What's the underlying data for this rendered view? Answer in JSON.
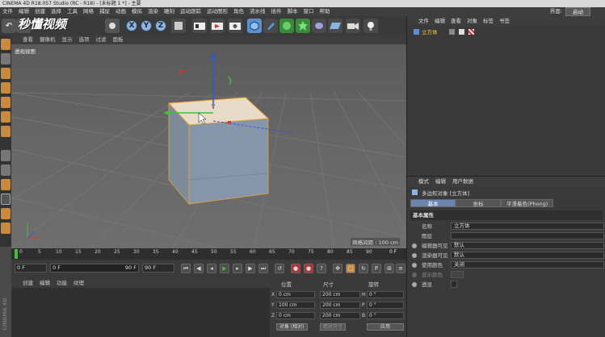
{
  "titlebar": {
    "text": "CINEMA 4D R18.057 Studio (RC - R18) - [未标题 1 *] - 主要"
  },
  "menubar": {
    "items": [
      "文件",
      "编辑",
      "创建",
      "选择",
      "工具",
      "网格",
      "捕捉",
      "动画",
      "模拟",
      "渲染",
      "雕刻",
      "运动跟踪",
      "运动图形",
      "角色",
      "流水线",
      "插件",
      "脚本",
      "窗口",
      "帮助"
    ],
    "layout_label": "界面:",
    "layout_value": "启动"
  },
  "watermark": "秒懂视频",
  "toolbar": {
    "x_label": "X",
    "y_label": "Y",
    "z_label": "Z"
  },
  "viewport": {
    "menu": [
      "查看",
      "摄像机",
      "显示",
      "选项",
      "过滤",
      "面板"
    ],
    "label": "透视视图",
    "grid_label": "网格间距 : 100 cm"
  },
  "timeline": {
    "ticks": [
      "0",
      "5",
      "10",
      "15",
      "20",
      "25",
      "30",
      "35",
      "40",
      "45",
      "50",
      "55",
      "60",
      "65",
      "70",
      "75",
      "80",
      "85",
      "90"
    ],
    "end_frame": "0 F"
  },
  "playbar": {
    "current": "0 F",
    "start": "0 F",
    "range_end": "90 F",
    "end": "90 F"
  },
  "material_panel": {
    "menu": [
      "创建",
      "编辑",
      "功能",
      "纹理"
    ]
  },
  "brand": "CINEMA 4D",
  "coords": {
    "headers": [
      "位置",
      "尺寸",
      "旋转"
    ],
    "rows": [
      {
        "axis": "X",
        "pos": "0 cm",
        "size": "200 cm",
        "rot_label": "H",
        "rot": "0 °"
      },
      {
        "axis": "Y",
        "pos": "100 cm",
        "size": "200 cm",
        "rot_label": "P",
        "rot": "0 °"
      },
      {
        "axis": "Z",
        "pos": "0 cm",
        "size": "200 cm",
        "rot_label": "B",
        "rot": "0 °"
      }
    ],
    "mode_object": "对象 (相对)",
    "mode_size": "绝对尺寸",
    "apply": "应用"
  },
  "object_manager": {
    "menu": [
      "文件",
      "编辑",
      "查看",
      "对象",
      "标签",
      "书签"
    ],
    "object_name": "立方体"
  },
  "attributes": {
    "menu": [
      "模式",
      "编辑",
      "用户数据"
    ],
    "title": "多边形对象 [立方体]",
    "tabs": [
      "基本",
      "坐标",
      "平滑着色(Phong)"
    ],
    "section": "基本属性",
    "rows": [
      {
        "label": "名称",
        "value": "立方体"
      },
      {
        "label": "图层",
        "value": ""
      },
      {
        "label": "编辑器可见",
        "value": "默认"
      },
      {
        "label": "渲染器可见",
        "value": "默认"
      },
      {
        "label": "使用颜色",
        "value": "关闭"
      },
      {
        "label": "显示颜色",
        "value": ""
      },
      {
        "label": "透显",
        "value": ""
      }
    ]
  },
  "colors": {
    "accent_orange": "#c88a3c",
    "selection_yellow": "#ffce3c",
    "axis_red": "#d93a2a",
    "axis_green": "#3ac23a",
    "axis_blue": "#2a5ad9"
  }
}
